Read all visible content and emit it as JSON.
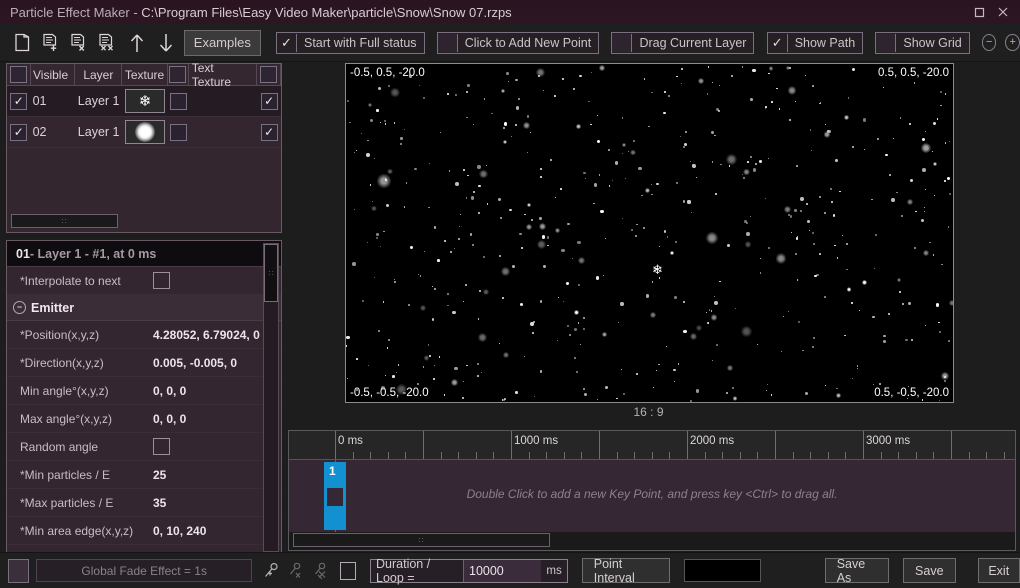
{
  "window": {
    "app_title": "Particle Effect Maker",
    "separator": " - ",
    "file_path": "C:\\Program Files\\Easy Video Maker\\particle\\Snow\\Snow 07.rzps",
    "maximize_icon": "maximize-icon",
    "close_icon": "close-icon",
    "accent": "#2d1624"
  },
  "toolbar": {
    "icons": [
      {
        "name": "new-layer-icon"
      },
      {
        "name": "add-point-icon"
      },
      {
        "name": "delete-point-icon"
      },
      {
        "name": "delete-all-points-icon"
      },
      {
        "name": "move-up-icon"
      },
      {
        "name": "move-down-icon"
      }
    ],
    "examples_label": "Examples",
    "toggles": [
      {
        "label": "Start with Full status",
        "checked": true
      },
      {
        "label": "Click to Add New Point",
        "checked": false
      },
      {
        "label": "Drag Current Layer",
        "checked": false
      },
      {
        "label": "Show Path",
        "checked": true
      },
      {
        "label": "Show Grid",
        "checked": false
      }
    ],
    "zoom_out_label": "−",
    "zoom_in_label": "+"
  },
  "layer_table": {
    "headers": [
      "",
      "Visible",
      "Layer",
      "Texture",
      "",
      "Text Texture",
      ""
    ],
    "rows": [
      {
        "visible": true,
        "index": "01",
        "layer": "Layer 1",
        "texture_icon": "snowflake-texture",
        "text_texture_checked": false,
        "text_texture": "",
        "last_checked": true
      },
      {
        "visible": true,
        "index": "02",
        "layer": "Layer 1",
        "texture_icon": "glow-dot-texture",
        "text_texture_checked": false,
        "text_texture": "",
        "last_checked": true
      }
    ]
  },
  "properties": {
    "title_main": "01",
    "title_rest": " - Layer 1 - #1, at 0 ms",
    "rows": [
      {
        "label": "*Interpolate to next",
        "type": "checkbox",
        "checked": false
      },
      {
        "label": "Emitter",
        "type": "section",
        "collapse_icon": "collapse-minus-icon"
      },
      {
        "label": "*Position(x,y,z)",
        "type": "text",
        "value": "4.28052, 6.79024, 0"
      },
      {
        "label": "*Direction(x,y,z)",
        "type": "text",
        "value": "0.005, -0.005, 0"
      },
      {
        "label": "Min angle°(x,y,z)",
        "type": "text",
        "value": "0, 0, 0"
      },
      {
        "label": "Max angle°(x,y,z)",
        "type": "text",
        "value": "0, 0, 0"
      },
      {
        "label": "Random angle",
        "type": "checkbox",
        "checked": false
      },
      {
        "label": "*Min particles / E",
        "type": "text",
        "value": "25"
      },
      {
        "label": "*Max particles / E",
        "type": "text",
        "value": "35"
      },
      {
        "label": "*Min area edge(x,y,z)",
        "type": "text",
        "value": "0, 10, 240"
      }
    ]
  },
  "preview": {
    "corner_top_left": "-0.5, 0.5, -20.0",
    "corner_top_right": "0.5, 0.5, -20.0",
    "corner_bottom_left": "-0.5, -0.5, -20.0",
    "corner_bottom_right": "0.5, -0.5, -20.0",
    "aspect_ratio": "16 : 9",
    "selected_particle_icon": "snowflake-marker"
  },
  "timeline": {
    "tick_labels": [
      "0 ms",
      "1000 ms",
      "2000 ms",
      "3000 ms"
    ],
    "hint": "Double Click to add a new Key Point, and press key <Ctrl> to drag all.",
    "keyframe_number": "1",
    "keyframe_color": "#1390d0"
  },
  "bottom": {
    "color_swatch": "#3a2f3a",
    "fade_label": "Global Fade Effect = 1s",
    "key_icons": [
      {
        "name": "add-key-icon"
      },
      {
        "name": "delete-key-icon"
      },
      {
        "name": "delete-all-keys-icon"
      }
    ],
    "loop_checkbox_checked": false,
    "duration_label": "Duration / Loop =",
    "duration_value": "10000",
    "duration_unit": "ms",
    "point_interval_label": "Point Interval",
    "save_as_label": "Save As",
    "save_label": "Save",
    "exit_label": "Exit"
  }
}
